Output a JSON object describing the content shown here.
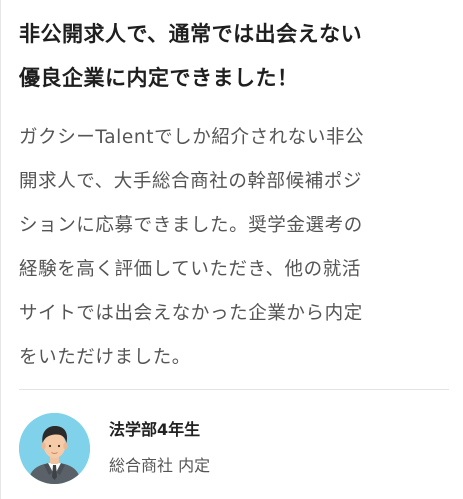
{
  "testimonial": {
    "headline_line1": "非公開求人で、通常では出会えない",
    "headline_line2": "優良企業に内定できました！",
    "body_lines": [
      "ガクシーTalentでしか紹介されない非公",
      "開求人で、大手総合商社の幹部候補ポジ",
      "ションに応募できました。奨学金選考の",
      "経験を高く評価していただき、他の就活",
      "サイトでは出会えなかった企業から内定",
      "をいただけました。"
    ],
    "person": {
      "avatar_icon": "student-avatar-icon",
      "name": "法学部4年生",
      "result": "総合商社 内定"
    }
  },
  "colors": {
    "headline": "#1f1f1f",
    "body_text": "#555555",
    "divider": "#e4e4e4",
    "avatar_background": "#7fd2e9"
  }
}
